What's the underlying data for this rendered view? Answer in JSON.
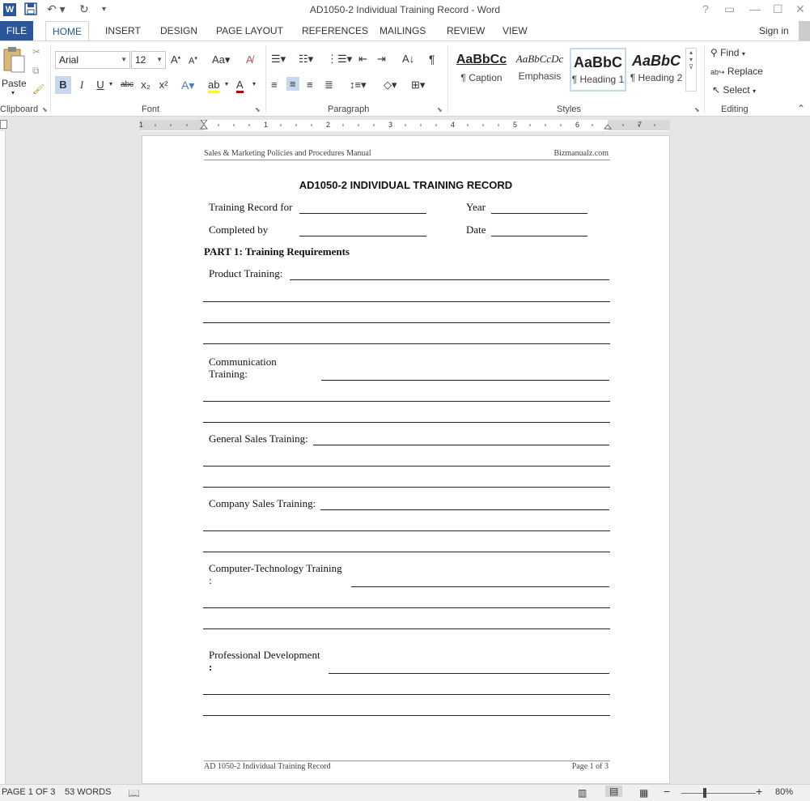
{
  "window": {
    "title": "AD1050-2 Individual Training Record - Word",
    "app_icon": "W",
    "qat_icons": [
      "save-icon",
      "undo-icon",
      "redo-icon",
      "customize-qat-icon"
    ],
    "controls": [
      "?",
      "ribbon-display-icon",
      "minimize-icon",
      "maximize-icon",
      "close-icon"
    ]
  },
  "tabs": {
    "file": "FILE",
    "items": [
      "HOME",
      "INSERT",
      "DESIGN",
      "PAGE LAYOUT",
      "REFERENCES",
      "MAILINGS",
      "REVIEW",
      "VIEW"
    ],
    "active": "HOME",
    "sign_in": "Sign in"
  },
  "ribbon": {
    "clipboard": {
      "label": "Clipboard",
      "paste": "Paste"
    },
    "font": {
      "label": "Font",
      "family": "Arial",
      "size": "12",
      "buttons": [
        "B",
        "I",
        "U",
        "abc",
        "x₂",
        "x²"
      ]
    },
    "paragraph": {
      "label": "Paragraph"
    },
    "styles": {
      "label": "Styles",
      "items": [
        {
          "preview": "AaBbCc",
          "name": "¶ Caption"
        },
        {
          "preview": "AaBbCcDc",
          "name": "Emphasis"
        },
        {
          "preview": "AaBbC",
          "name": "¶ Heading 1"
        },
        {
          "preview": "AaBbC",
          "name": "¶ Heading 2"
        }
      ]
    },
    "editing": {
      "label": "Editing",
      "find": "Find",
      "replace": "Replace",
      "select": "Select"
    }
  },
  "ruler": {
    "numbers": [
      "1",
      "1",
      "2",
      "3",
      "4",
      "5",
      "6",
      "7"
    ]
  },
  "document": {
    "header_left": "Sales & Marketing Policies and Procedures Manual",
    "header_right": "Bizmanualz.com",
    "title": "AD1050-2 INDIVIDUAL TRAINING RECORD",
    "training_record_for": "Training Record for",
    "year": "Year",
    "completed_by": "Completed by",
    "date": "Date",
    "part1": "PART 1:  Training Requirements",
    "product_training": "Product Training:",
    "communication_training_1": "Communication",
    "communication_training_2": "Training:",
    "general_sales_training": "General Sales Training:",
    "company_sales_training": "Company Sales Training:",
    "computer_tech_training_1": "Computer-Technology Training",
    "computer_tech_training_2": ":",
    "professional_dev_1": "Professional Development",
    "professional_dev_2": ":",
    "footer_left": "AD 1050-2 Individual Training Record",
    "footer_right": "Page 1 of 3"
  },
  "status": {
    "page": "PAGE 1 OF 3",
    "words": "53 WORDS",
    "zoom": "80%"
  }
}
